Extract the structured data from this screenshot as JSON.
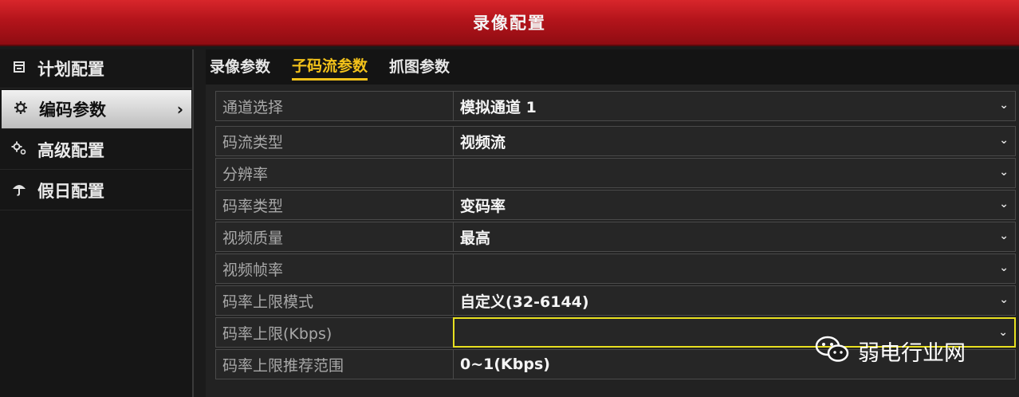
{
  "window": {
    "title": "录像配置"
  },
  "sidebar": {
    "items": [
      {
        "label": "计划配置",
        "icon": "calendar-icon"
      },
      {
        "label": "编码参数",
        "icon": "gear-icon",
        "active": true,
        "chevron": "›"
      },
      {
        "label": "高级配置",
        "icon": "advanced-gear-icon"
      },
      {
        "label": "假日配置",
        "icon": "umbrella-icon"
      }
    ]
  },
  "tabs": [
    {
      "label": "录像参数"
    },
    {
      "label": "子码流参数",
      "active": true
    },
    {
      "label": "抓图参数"
    }
  ],
  "form": {
    "rows": [
      {
        "label": "通道选择",
        "value": "模拟通道 1",
        "dropdown": true
      },
      {
        "label": "码流类型",
        "value": "视频流",
        "dropdown": true
      },
      {
        "label": "分辨率",
        "value": "",
        "dropdown": true
      },
      {
        "label": "码率类型",
        "value": "变码率",
        "dropdown": true
      },
      {
        "label": "视频质量",
        "value": "最高",
        "dropdown": true
      },
      {
        "label": "视频帧率",
        "value": "",
        "dropdown": true
      },
      {
        "label": "码率上限模式",
        "value": "自定义(32-6144)",
        "dropdown": true
      },
      {
        "label": "码率上限(Kbps)",
        "value": "",
        "dropdown": true,
        "highlighted": true
      },
      {
        "label": "码率上限推荐范围",
        "value": "0~1(Kbps)",
        "dropdown": false
      }
    ]
  },
  "watermark": {
    "text": "弱电行业网",
    "icon": "wechat-icon"
  },
  "colors": {
    "title_bar": "#c41a20",
    "active_tab": "#f3c21a",
    "focus_border": "#e8e020"
  }
}
